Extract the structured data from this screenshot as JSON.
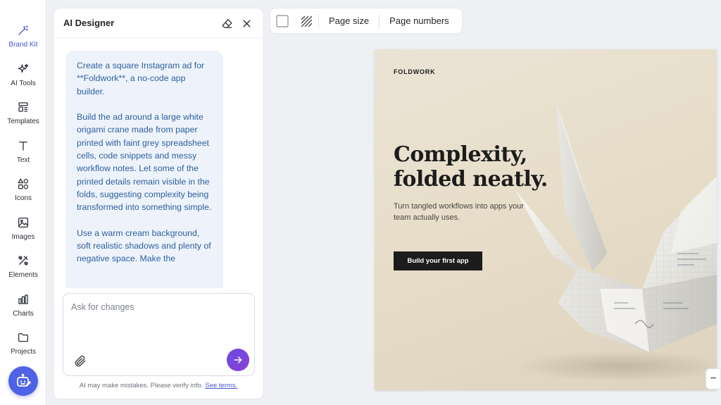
{
  "rail": {
    "items": [
      {
        "label": "Brand Kit",
        "icon": "magic-wand-icon"
      },
      {
        "label": "AI Tools",
        "icon": "sparkles-icon"
      },
      {
        "label": "Templates",
        "icon": "templates-icon"
      },
      {
        "label": "Text",
        "icon": "text-icon"
      },
      {
        "label": "Icons",
        "icon": "shapes-icon"
      },
      {
        "label": "Images",
        "icon": "image-icon"
      },
      {
        "label": "Elements",
        "icon": "elements-icon"
      },
      {
        "label": "Charts",
        "icon": "bar-chart-icon"
      },
      {
        "label": "Projects",
        "icon": "folder-icon"
      }
    ],
    "active": "Brand Kit"
  },
  "panel": {
    "title": "AI Designer",
    "message": {
      "p1": "Create a square Instagram ad for **Foldwork**, a no-code app builder.",
      "p2": "Build the ad around a large white origami crane made from paper printed with faint grey spreadsheet cells, code snippets and messy workflow notes. Let some of the printed details remain visible in the folds, suggesting complexity being transformed into something simple.",
      "p3": "Use a warm cream background, soft realistic shadows and plenty of negative space. Make the"
    },
    "input_placeholder": "Ask for changes",
    "disclaimer": "AI may make mistakes. Please verify info.",
    "terms_link": "See terms."
  },
  "toolbar": {
    "page_size": "Page size",
    "page_numbers": "Page numbers"
  },
  "canvas": {
    "brand": "FOLDWORK",
    "headline_1": "Complexity,",
    "headline_2": "folded neatly.",
    "subhead": "Turn tangled workflows into apps your team actually uses.",
    "cta": "Build your first app"
  },
  "zoom_out": "−",
  "colors": {
    "accent": "#4e62e6",
    "send_gradient_start": "#6a4be0",
    "canvas_bg": "#e7ddc9",
    "message_text": "#2d5f9e"
  }
}
